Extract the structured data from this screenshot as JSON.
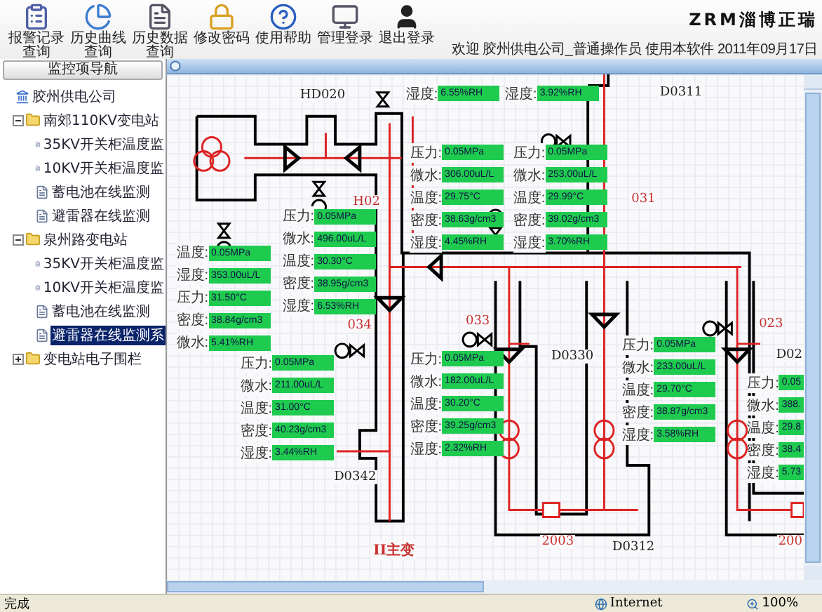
{
  "toolbar": [
    {
      "kind": "report",
      "label": "报警记录查询"
    },
    {
      "kind": "curve",
      "label": "历史曲线查询"
    },
    {
      "kind": "data",
      "label": "历史数据查询"
    },
    {
      "kind": "password",
      "label": "修改密码"
    },
    {
      "kind": "help",
      "label": "使用帮助"
    },
    {
      "kind": "admin",
      "label": "管理登录"
    },
    {
      "kind": "logout",
      "label": "退出登录"
    }
  ],
  "brand": "ZRM淄博正瑞",
  "welcome": "欢迎 胶州供电公司_普通操作员 使用本软件 2011年09月17日",
  "sidebar": {
    "title": "监控项导航",
    "tree": [
      {
        "kind": "root",
        "label": "胶州供电公司",
        "selected": false,
        "children": [
          {
            "kind": "folder",
            "label": "南郊110KV变电站",
            "expanded": true,
            "selected": false,
            "children": [
              {
                "kind": "page",
                "label": "35KV开关柜温度监",
                "selected": false
              },
              {
                "kind": "page",
                "label": "10KV开关柜温度监",
                "selected": false
              },
              {
                "kind": "page",
                "label": "蓄电池在线监测",
                "selected": false
              },
              {
                "kind": "page",
                "label": "避雷器在线监测",
                "selected": false
              }
            ]
          },
          {
            "kind": "folder",
            "label": "泉州路变电站",
            "expanded": true,
            "selected": false,
            "children": [
              {
                "kind": "page",
                "label": "35KV开关柜温度监",
                "selected": false
              },
              {
                "kind": "page",
                "label": "10KV开关柜温度监",
                "selected": false
              },
              {
                "kind": "page",
                "label": "蓄电池在线监测",
                "selected": false
              },
              {
                "kind": "page",
                "label": "避雷器在线监测系",
                "selected": true
              }
            ]
          },
          {
            "kind": "folder",
            "label": "变电站电子围栏",
            "expanded": false,
            "selected": false
          }
        ]
      }
    ]
  },
  "diagram": {
    "labels": [
      {
        "kind": "device",
        "text": "HD020"
      },
      {
        "kind": "device",
        "text": "D0311"
      },
      {
        "kind": "circuit",
        "text": "H02"
      },
      {
        "kind": "circuit",
        "text": "031"
      },
      {
        "kind": "circuit",
        "text": "034"
      },
      {
        "kind": "circuit",
        "text": "033"
      },
      {
        "kind": "circuit",
        "text": "023"
      },
      {
        "kind": "device",
        "text": "D0330"
      },
      {
        "kind": "device",
        "text": "D02"
      },
      {
        "kind": "device",
        "text": "D0342"
      },
      {
        "kind": "transformer",
        "text": "II主变"
      },
      {
        "kind": "circuit",
        "text": "2003"
      },
      {
        "kind": "device",
        "text": "D0312"
      },
      {
        "kind": "circuit",
        "text": "200"
      }
    ],
    "readings": [
      {
        "rows": [
          {
            "label": "湿度:",
            "value": "6.55%RH"
          }
        ]
      },
      {
        "rows": [
          {
            "label": "湿度:",
            "value": "3.92%RH"
          }
        ]
      },
      {
        "rows": [
          {
            "label": "压力:",
            "value": "0.05MPa"
          },
          {
            "label": "微水:",
            "value": "306.00uL/L"
          },
          {
            "label": "温度:",
            "value": "29.75°C"
          },
          {
            "label": "密度:",
            "value": "38.63g/cm3"
          },
          {
            "label": "湿度:",
            "value": "4.45%RH"
          }
        ]
      },
      {
        "rows": [
          {
            "label": "压力:",
            "value": "0.05MPa"
          },
          {
            "label": "微水:",
            "value": "253.00uL/L"
          },
          {
            "label": "温度:",
            "value": "29.99°C"
          },
          {
            "label": "密度:",
            "value": "39.02g/cm3"
          },
          {
            "label": "湿度:",
            "value": "3.70%RH"
          }
        ]
      },
      {
        "rows": [
          {
            "label": "压力:",
            "value": "0.05MPa"
          },
          {
            "label": "微水:",
            "value": "496.00uL/L"
          },
          {
            "label": "温度:",
            "value": "30.30°C"
          },
          {
            "label": "密度:",
            "value": "38.95g/cm3"
          },
          {
            "label": "湿度:",
            "value": "6.53%RH"
          }
        ]
      },
      {
        "rows": [
          {
            "label": "温度:",
            "value": "0.05MPa"
          },
          {
            "label": "湿度:",
            "value": "353.00uL/L"
          },
          {
            "label": "压力:",
            "value": "31.50°C"
          },
          {
            "label": "密度:",
            "value": "38.84g/cm3"
          },
          {
            "label": "微水:",
            "value": "5.41%RH"
          }
        ]
      },
      {
        "rows": [
          {
            "label": "压力:",
            "value": "0.05MPa"
          },
          {
            "label": "微水:",
            "value": "211.00uL/L"
          },
          {
            "label": "温度:",
            "value": "31.00°C"
          },
          {
            "label": "密度:",
            "value": "40.23g/cm3"
          },
          {
            "label": "湿度:",
            "value": "3.44%RH"
          }
        ]
      },
      {
        "rows": [
          {
            "label": "压力:",
            "value": "0.05MPa"
          },
          {
            "label": "微水:",
            "value": "182.00uL/L"
          },
          {
            "label": "温度:",
            "value": "30.20°C"
          },
          {
            "label": "密度:",
            "value": "39.25g/cm3"
          },
          {
            "label": "湿度:",
            "value": "2.32%RH"
          }
        ]
      },
      {
        "rows": [
          {
            "label": "压力:",
            "value": "0.05MPa"
          },
          {
            "label": "微水:",
            "value": "233.00uL/L"
          },
          {
            "label": "温度:",
            "value": "29.70°C"
          },
          {
            "label": "密度:",
            "value": "38.87g/cm3"
          },
          {
            "label": "湿度:",
            "value": "3.58%RH"
          }
        ]
      },
      {
        "rows": [
          {
            "label": "压力:",
            "value": "0.05"
          },
          {
            "label": "微水:",
            "value": "388."
          },
          {
            "label": "温度:",
            "value": "29.8"
          },
          {
            "label": "密度:",
            "value": "38.4"
          },
          {
            "label": "湿度:",
            "value": "5.73"
          }
        ]
      }
    ]
  },
  "status": {
    "text": "完成",
    "zone": "Internet",
    "zoom": "100%"
  }
}
